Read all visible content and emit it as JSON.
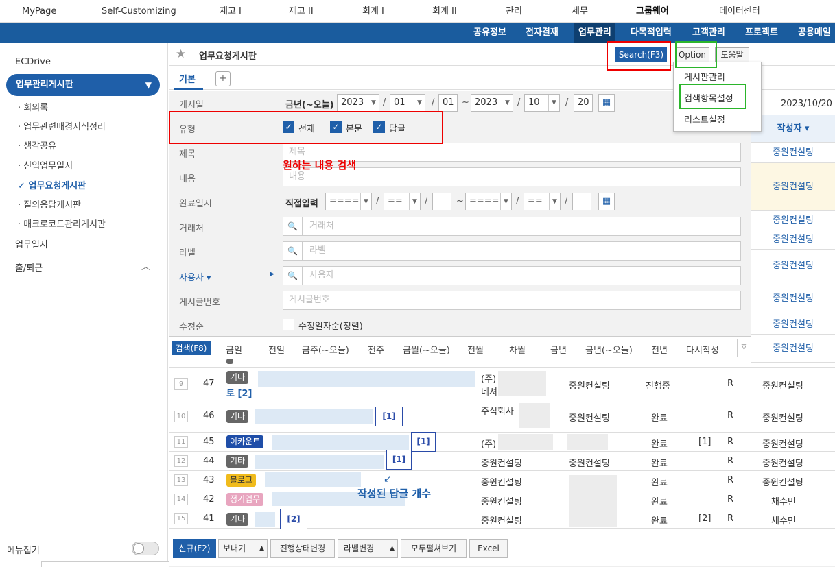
{
  "topnav": {
    "items": [
      "MyPage",
      "Self-Customizing",
      "재고 I",
      "재고 II",
      "회계 I",
      "회계 II",
      "관리",
      "세무",
      "그룹웨어",
      "데이터센터"
    ]
  },
  "subnav": {
    "items": [
      "공유정보",
      "전자결재",
      "업무관리",
      "다목적입력",
      "고객관리",
      "프로젝트",
      "공용메일"
    ]
  },
  "sidebar": {
    "ecdrive": "ECDrive",
    "board": "업무관리게시판",
    "subitems": [
      "회의록",
      "업무관련배경지식정리",
      "생각공유",
      "신입업무일지",
      "업무요청게시판",
      "질의응답게시판",
      "매크로코드관리게시판"
    ],
    "worklog": "업무일지",
    "attendance": "출/퇴근",
    "menufold": "메뉴접기"
  },
  "header": {
    "title": "업무요청게시판",
    "search": "Search(F3)",
    "option": "Option",
    "help": "도움말"
  },
  "optionmenu": {
    "items": [
      "게시판관리",
      "검색항목설정",
      "리스트설정"
    ]
  },
  "tabs": {
    "basic": "기본",
    "plus": "+"
  },
  "form": {
    "postdate": {
      "label": "게시일",
      "range": "금년(~오늘)",
      "y1": "2023",
      "m1": "01",
      "d1": "01",
      "tilde": "~",
      "y2": "2023",
      "m2": "10",
      "d2": "20"
    },
    "type": {
      "label": "유형",
      "all": "전체",
      "body": "본문",
      "reply": "답글"
    },
    "title": {
      "label": "제목",
      "placeholder": "제목"
    },
    "content": {
      "label": "내용",
      "placeholder": "내용"
    },
    "done": {
      "label": "완료일시",
      "mode": "직접입력",
      "y": "====",
      "m": "==",
      "y2": "====",
      "m2": "=="
    },
    "client": {
      "label": "거래처",
      "placeholder": "거래처"
    },
    "tag": {
      "label": "라벨",
      "placeholder": "라벨"
    },
    "user": {
      "label": "사용자",
      "placeholder": "사용자"
    },
    "postno": {
      "label": "게시글번호",
      "placeholder": "게시글번호"
    },
    "order": {
      "label": "수정순",
      "check": "수정일자순(정렬)"
    }
  },
  "annotations": {
    "search": "원하는 내용 검색",
    "reply": "작성된 답글 개수"
  },
  "datebar": {
    "search": "검색(F8)",
    "items": [
      "금일",
      "전일",
      "금주(~오늘)",
      "전주",
      "금월(~오늘)",
      "전월",
      "차월",
      "금년",
      "금년(~오늘)",
      "전년",
      "다시작성"
    ]
  },
  "rightcol": {
    "date": "2023/10/20",
    "header": "작성자",
    "values": [
      "중원컨설팅",
      "중원컨설팅",
      "중원컨설팅",
      "중원컨설팅",
      "중원컨설팅",
      "중원컨설팅",
      "중원컨설팅",
      "중원컨설팅"
    ]
  },
  "rows": [
    {
      "num": "9",
      "no": "47",
      "tag": "기타",
      "title": "토 [2]",
      "client": "(주)",
      "client2": "네셔",
      "writer": "중원컨설팅",
      "status": "진행중",
      "reply": "",
      "r": "R",
      "author": "중원컨설팅"
    },
    {
      "num": "10",
      "no": "46",
      "tag": "기타",
      "title": "[1]",
      "client": "주식회사",
      "writer": "중원컨설팅",
      "status": "완료",
      "reply": "",
      "r": "R",
      "author": "중원컨설팅"
    },
    {
      "num": "11",
      "no": "45",
      "tag": "이카운트",
      "title": "[1]",
      "client": "(주)",
      "writer": "",
      "status": "완료",
      "reply": "[1]",
      "r": "R",
      "author": "중원컨설팅"
    },
    {
      "num": "12",
      "no": "44",
      "tag": "기타",
      "title": "[1]",
      "client": "중원컨설팅",
      "writer": "중원컨설팅",
      "status": "완료",
      "reply": "",
      "r": "R",
      "author": "중원컨설팅"
    },
    {
      "num": "13",
      "no": "43",
      "tag": "블로그",
      "title": "",
      "client": "중원컨설팅",
      "writer": "",
      "status": "완료",
      "reply": "",
      "r": "R",
      "author": "중원컨설팅"
    },
    {
      "num": "14",
      "no": "42",
      "tag": "정기업무",
      "title": "",
      "client": "중원컨설팅",
      "writer": "",
      "status": "완료",
      "reply": "",
      "r": "R",
      "author": "채수민"
    },
    {
      "num": "15",
      "no": "41",
      "tag": "기타",
      "title": "[2]",
      "client": "중원컨설팅",
      "writer": "",
      "status": "완료",
      "reply": "[2]",
      "r": "R",
      "author": "채수민"
    }
  ],
  "bottombar": {
    "new": "신규(F2)",
    "send": "보내기",
    "status": "진행상태변경",
    "label": "라벨변경",
    "expand": "모두펼쳐보기",
    "excel": "Excel"
  }
}
